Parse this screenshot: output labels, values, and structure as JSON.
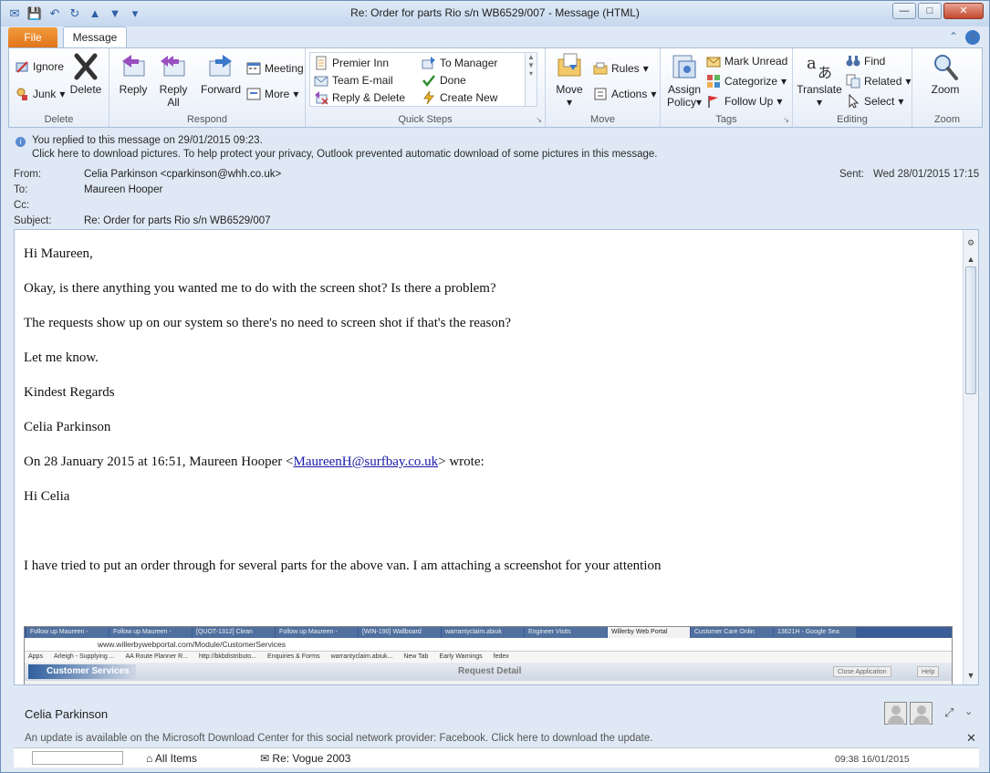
{
  "window": {
    "title": "Re: Order for parts Rio s/n WB6529/007  -  Message (HTML)",
    "controls": {
      "minimize": "—",
      "maximize": "□",
      "close": "✕"
    }
  },
  "tabs": {
    "file": "File",
    "message": "Message"
  },
  "ribbon": {
    "delete": {
      "label": "Delete",
      "ignore": "Ignore",
      "junk": "Junk",
      "delete_btn": "Delete"
    },
    "respond": {
      "label": "Respond",
      "reply": "Reply",
      "reply_all_1": "Reply",
      "reply_all_2": "All",
      "forward": "Forward",
      "meeting": "Meeting",
      "more": "More"
    },
    "quick_steps": {
      "label": "Quick Steps",
      "items": [
        "Premier Inn",
        "To Manager",
        "Team E-mail",
        "Done",
        "Reply & Delete",
        "Create New"
      ]
    },
    "move": {
      "label": "Move",
      "move_btn": "Move",
      "rules": "Rules",
      "actions": "Actions"
    },
    "tags": {
      "label": "Tags",
      "assign_1": "Assign",
      "assign_2": "Policy",
      "mark_unread": "Mark Unread",
      "categorize": "Categorize",
      "follow_up": "Follow Up"
    },
    "editing": {
      "label": "Editing",
      "translate": "Translate",
      "find": "Find",
      "related": "Related",
      "select": "Select"
    },
    "zoom": {
      "label": "Zoom",
      "zoom_btn": "Zoom"
    }
  },
  "info": {
    "replied": "You replied to this message on 29/01/2015 09:23.",
    "pictures": "Click here to download pictures. To help protect your privacy, Outlook prevented automatic download of some pictures in this message."
  },
  "header": {
    "from_label": "From:",
    "from": "Celia Parkinson <cparkinson@whh.co.uk>",
    "to_label": "To:",
    "to": "Maureen Hooper",
    "cc_label": "Cc:",
    "cc": "",
    "subject_label": "Subject:",
    "subject": "Re: Order for parts Rio s/n WB6529/007",
    "sent_label": "Sent:",
    "sent": "Wed 28/01/2015 17:15"
  },
  "body": {
    "p1": "Hi Maureen,",
    "p2": "Okay, is there anything you wanted me to do with the screen shot? Is there a problem?",
    "p3": "The requests show up on our system so there's no need to screen shot if that's the reason?",
    "p4": "Let me know.",
    "p5": "Kindest Regards",
    "p6": "Celia Parkinson",
    "quote_pre": "On 28 January 2015 at 16:51, Maureen Hooper <",
    "quote_email": "MaureenH@surfbay.co.uk",
    "quote_post": "> wrote:",
    "p8": "Hi Celia",
    "p9": "I have tried to put an order through for several parts for the above van.  I am attaching a screenshot for your attention"
  },
  "embedded": {
    "tabs": [
      "Follow up Maureen -",
      "Follow up Maureen -",
      "[QUOT-1312] Clean",
      "Follow up Maureen -",
      "[WIN-190] Wallboard",
      "warrantyclaim.abiuk",
      "Engineer Visits",
      "Willerby Web Portal",
      "Customer Care Onlin",
      "13621H - Google Sea"
    ],
    "url": "www.willerbywebportal.com/Module/CustomerServices",
    "bookmarks": [
      "Apps",
      "Arleigh - Supplying ...",
      "AA Route Planner R...",
      "http://bkbdistributo...",
      "Enquiries & Forms",
      "warrantyclaim.abiuk...",
      "New Tab",
      "Early Warnings",
      "fedex"
    ],
    "brand": "Customer Services",
    "title": "Request Detail",
    "close_app": "Close Application",
    "help": "Help"
  },
  "people": {
    "name": "Celia Parkinson",
    "update": "An update is available on the Microsoft Download Center for this social network provider: Facebook. Click here to download the update."
  },
  "bottom": {
    "all_items": "All Items",
    "item": "Re: Vogue 2003",
    "time": "09:38 16/01/2015"
  }
}
